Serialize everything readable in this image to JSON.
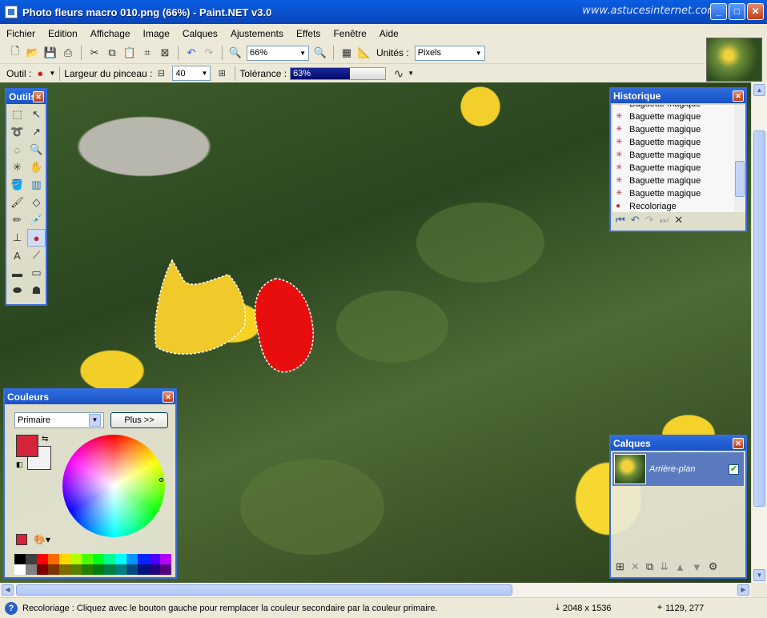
{
  "window": {
    "title": "Photo fleurs macro 010.png (66%) - Paint.NET v3.0",
    "watermark": "www.astucesinternet.com"
  },
  "menu": [
    "Fichier",
    "Edition",
    "Affichage",
    "Image",
    "Calques",
    "Ajustements",
    "Effets",
    "Fenêtre",
    "Aide"
  ],
  "toolbar": {
    "zoom": "66%",
    "units_label": "Unités :",
    "units_value": "Pixels"
  },
  "tool_options": {
    "tool_label": "Outil :",
    "brush_width_label": "Largeur du pinceau :",
    "brush_width_value": "40",
    "tolerance_label": "Tolérance :",
    "tolerance_value": "63%",
    "tolerance_fraction": 0.63
  },
  "tools_panel": {
    "title": "Outils",
    "tools": [
      "rectangle-select-icon",
      "move-selection-icon",
      "lasso-select-icon",
      "move-pixels-icon",
      "ellipse-select-icon",
      "zoom-icon",
      "magic-wand-icon",
      "pan-hand-icon",
      "paint-bucket-icon",
      "gradient-icon",
      "paintbrush-icon",
      "eraser-icon",
      "pencil-icon",
      "color-picker-icon",
      "clone-stamp-icon",
      "recolor-icon",
      "text-icon",
      "line-curve-icon",
      "rectangle-icon",
      "rounded-rectangle-icon",
      "ellipse-icon",
      "freeform-shape-icon"
    ],
    "active_tool": "recolor-icon"
  },
  "history": {
    "title": "Historique",
    "items": [
      {
        "label": "Baguette magique",
        "icon": "magic-wand-icon"
      },
      {
        "label": "Baguette magique",
        "icon": "magic-wand-icon"
      },
      {
        "label": "Baguette magique",
        "icon": "magic-wand-icon"
      },
      {
        "label": "Baguette magique",
        "icon": "magic-wand-icon"
      },
      {
        "label": "Baguette magique",
        "icon": "magic-wand-icon"
      },
      {
        "label": "Baguette magique",
        "icon": "magic-wand-icon"
      },
      {
        "label": "Baguette magique",
        "icon": "magic-wand-icon"
      },
      {
        "label": "Baguette magique",
        "icon": "magic-wand-icon"
      },
      {
        "label": "Recoloriage",
        "icon": "recolor-icon"
      }
    ]
  },
  "colors": {
    "title": "Couleurs",
    "mode": "Primaire",
    "more_button": "Plus >>",
    "primary": "#d4253a",
    "secondary": "#f2f2f2",
    "palette_top": [
      "#000000",
      "#404040",
      "#ff0000",
      "#ff6a00",
      "#ffd800",
      "#b6ff00",
      "#4cff00",
      "#00ff21",
      "#00ff90",
      "#00ffff",
      "#0094ff",
      "#0026ff",
      "#4800ff",
      "#b200ff"
    ],
    "palette_bottom": [
      "#ffffff",
      "#808080",
      "#7f0000",
      "#7f3300",
      "#7f6a00",
      "#5b7f00",
      "#267f00",
      "#007f0e",
      "#007f46",
      "#007f7f",
      "#004a7f",
      "#00137f",
      "#21007f",
      "#57007f"
    ]
  },
  "layers": {
    "title": "Calques",
    "items": [
      {
        "name": "Arrière-plan",
        "visible": true
      }
    ]
  },
  "status": {
    "message": "Recoloriage : Cliquez avec le bouton gauche pour remplacer la couleur secondaire par la couleur primaire.",
    "image_size": "2048 x 1536",
    "cursor_pos": "1129, 277"
  }
}
